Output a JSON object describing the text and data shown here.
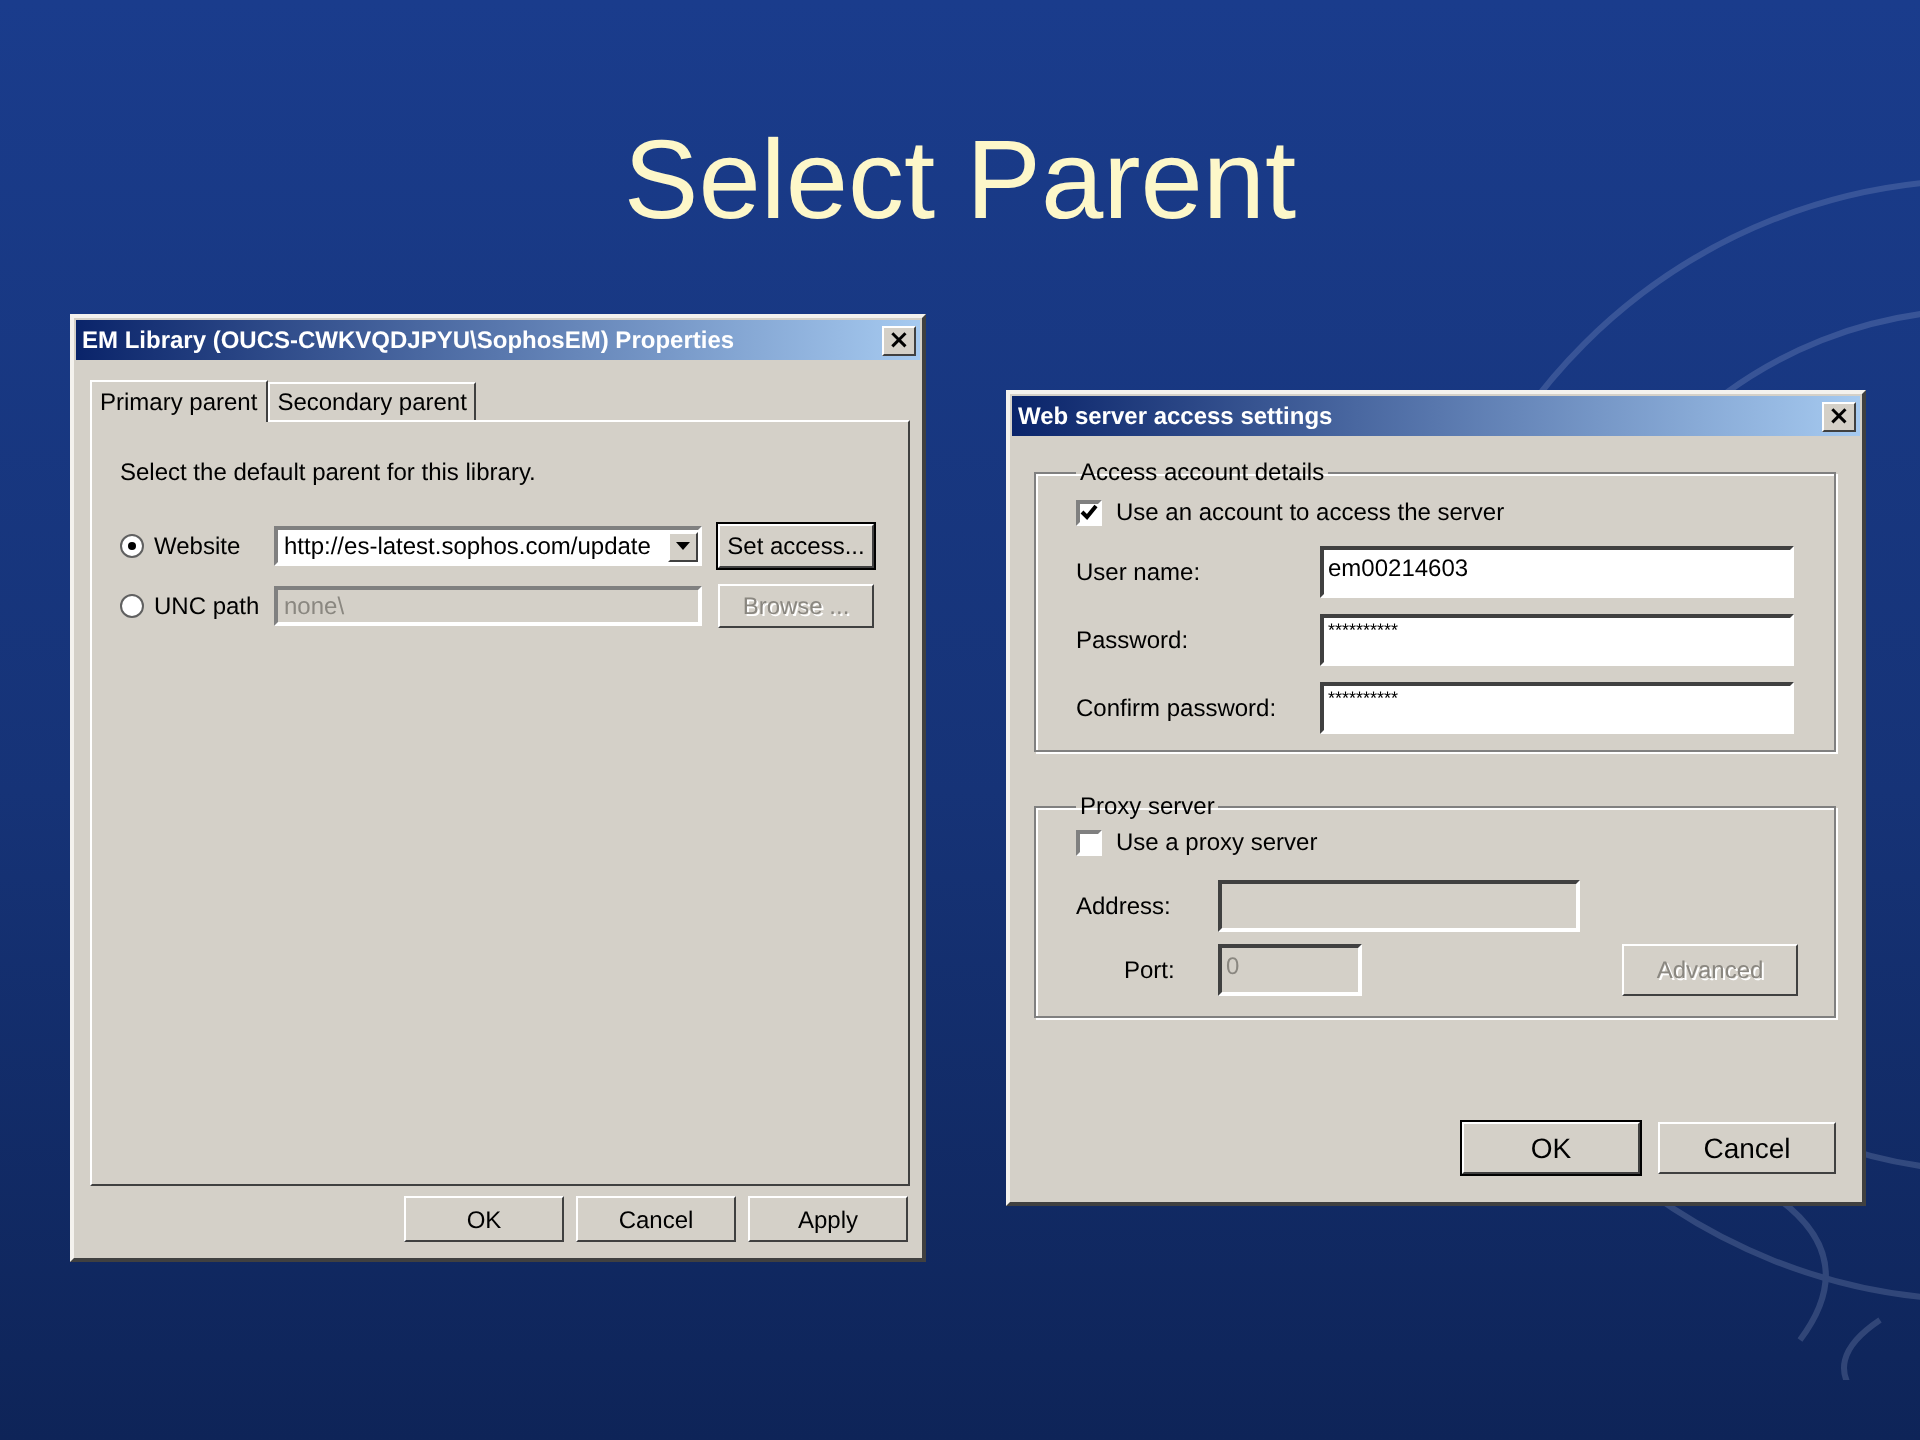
{
  "slide": {
    "title": "Select Parent"
  },
  "properties_dialog": {
    "title": "EM Library (OUCS-CWKVQDJPYU\\SophosEM) Properties",
    "close": "×",
    "tabs": [
      {
        "label": "Primary parent",
        "selected": true
      },
      {
        "label": "Secondary parent",
        "selected": false
      }
    ],
    "instruction": "Select the default parent for this library.",
    "options": [
      {
        "kind": "combo",
        "label": "Website",
        "selected": true,
        "disabled": false,
        "value": "http://es-latest.sophos.com/update",
        "button": {
          "label": "Set access...",
          "default": true,
          "disabled": false
        }
      },
      {
        "kind": "text",
        "label": "UNC path",
        "selected": false,
        "disabled": true,
        "value": "none\\",
        "button": {
          "label": "Browse ...",
          "default": false,
          "disabled": true
        }
      }
    ],
    "buttons": [
      {
        "label": "OK",
        "default": false,
        "disabled": false
      },
      {
        "label": "Cancel",
        "default": false,
        "disabled": false
      },
      {
        "label": "Apply",
        "default": false,
        "disabled": false
      }
    ]
  },
  "access_dialog": {
    "title": "Web server access settings",
    "close": "×",
    "groups": [
      {
        "legend": "Access account details",
        "checkbox": {
          "label": "Use an account to access the server",
          "checked": true
        },
        "disabled": false,
        "fields": [
          {
            "label": "User name:",
            "value": "em00214603",
            "kind": "plain"
          },
          {
            "label": "Password:",
            "value": "**********",
            "kind": "secret"
          },
          {
            "label": "Confirm password:",
            "value": "**********",
            "kind": "secret"
          }
        ]
      },
      {
        "legend": "Proxy server",
        "checkbox": {
          "label": "Use a proxy server",
          "checked": false
        },
        "disabled": true,
        "fields": [
          {
            "label": "Address:",
            "kind": "wide"
          },
          {
            "label": "Port:",
            "value": "0",
            "kind": "short"
          }
        ],
        "button": {
          "label": "Advanced",
          "default": false,
          "disabled": true
        }
      }
    ],
    "buttons": [
      {
        "label": "OK",
        "default": true,
        "disabled": false
      },
      {
        "label": "Cancel",
        "default": false,
        "disabled": false
      }
    ]
  }
}
